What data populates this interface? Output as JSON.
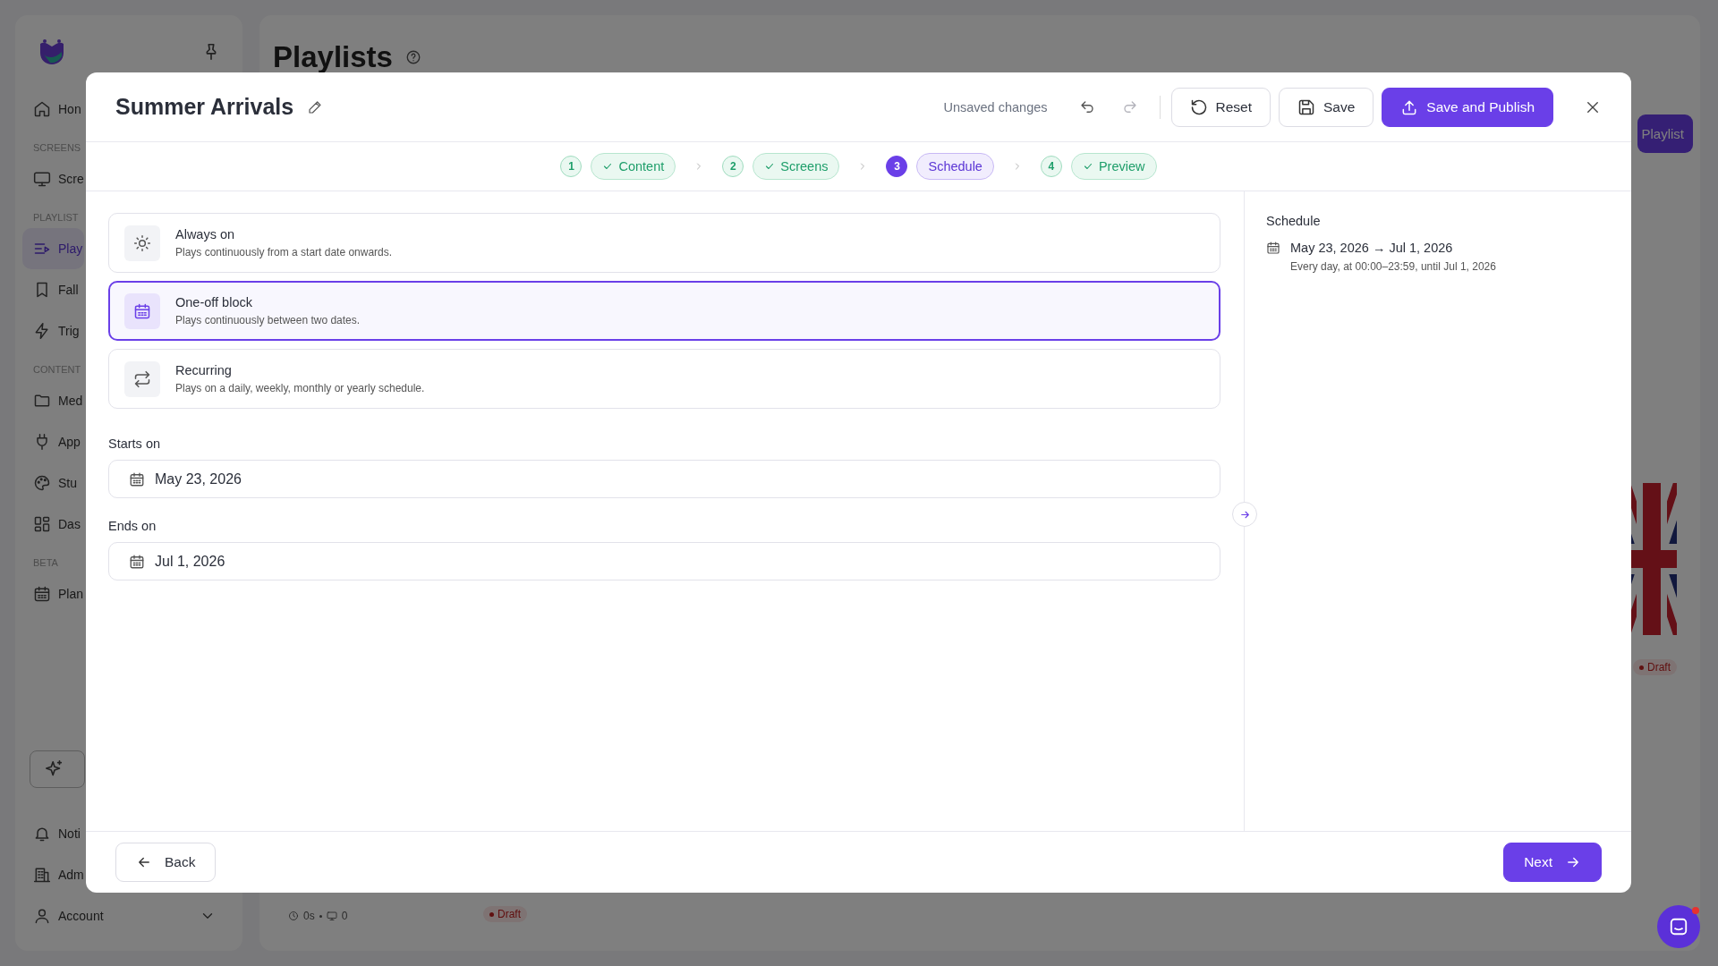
{
  "sidebar": {
    "items": [
      {
        "kind": "item",
        "label": "Hon",
        "selected": false
      },
      {
        "kind": "section",
        "label": "SCREENS"
      },
      {
        "kind": "item",
        "label": "Scre",
        "selected": false
      },
      {
        "kind": "section",
        "label": "PLAYLIST"
      },
      {
        "kind": "item",
        "label": "Play",
        "selected": true
      },
      {
        "kind": "item",
        "label": "Fall",
        "selected": false
      },
      {
        "kind": "item",
        "label": "Trig",
        "selected": false
      },
      {
        "kind": "section",
        "label": "CONTENT"
      },
      {
        "kind": "item",
        "label": "Med",
        "selected": false
      },
      {
        "kind": "item",
        "label": "App",
        "selected": false
      },
      {
        "kind": "item",
        "label": "Stu",
        "selected": false
      },
      {
        "kind": "item",
        "label": "Das",
        "selected": false
      },
      {
        "kind": "section",
        "label": "BETA"
      },
      {
        "kind": "item",
        "label": "Plan",
        "selected": false
      }
    ],
    "bottom_items": [
      {
        "label": "Noti"
      },
      {
        "label": "Adm"
      },
      {
        "label": "Account"
      }
    ]
  },
  "main": {
    "title": "Playlists",
    "new_button": "Playlist",
    "badges": [
      "Draft",
      "Draft"
    ],
    "card_meta": {
      "duration": "0s",
      "screens": "0"
    }
  },
  "modal": {
    "title": "Summer Arrivals",
    "status": "Unsaved changes",
    "undo_disabled": false,
    "redo_disabled": true,
    "actions": {
      "reset": "Reset",
      "save": "Save",
      "publish": "Save and Publish"
    },
    "steps": [
      {
        "number": "1",
        "label": "Content",
        "done": true,
        "selected": false
      },
      {
        "number": "2",
        "label": "Screens",
        "done": true,
        "selected": false
      },
      {
        "number": "3",
        "label": "Schedule",
        "done": false,
        "selected": true
      },
      {
        "number": "4",
        "label": "Preview",
        "done": true,
        "selected": false
      }
    ],
    "options": [
      {
        "title": "Always on",
        "description": "Plays continuously from a start date onwards.",
        "selected": false
      },
      {
        "title": "One-off block",
        "description": "Plays continuously between two dates.",
        "selected": true
      },
      {
        "title": "Recurring",
        "description": "Plays on a daily, weekly, monthly or yearly schedule.",
        "selected": false
      }
    ],
    "fields": [
      {
        "label": "Starts on",
        "value": "May 23, 2026"
      },
      {
        "label": "Ends on",
        "value": "Jul 1, 2026"
      }
    ],
    "summary": {
      "heading": "Schedule",
      "range": "May 23, 2026 → Jul 1, 2026",
      "detail": "Every day, at 00:00–23:59, until Jul 1, 2026"
    },
    "footer": {
      "back": "Back",
      "next": "Next"
    }
  }
}
